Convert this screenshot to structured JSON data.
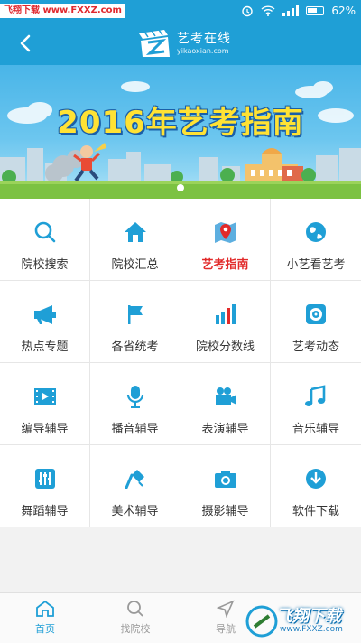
{
  "status_bar": {
    "watermark": "飞翔下载 www.FXXZ.com",
    "battery": "62%"
  },
  "header": {
    "back_icon": "chevron-left-icon",
    "logo_cn": "艺考在线",
    "logo_en": "yikaoxian.com"
  },
  "banner": {
    "title": "2016年艺考指南",
    "slides": 2,
    "active_slide": 0
  },
  "grid": [
    {
      "label": "院校搜索",
      "icon": "search-icon",
      "color": "#1f9fd6",
      "active": false
    },
    {
      "label": "院校汇总",
      "icon": "home-icon",
      "color": "#1f9fd6",
      "active": false
    },
    {
      "label": "艺考指南",
      "icon": "map-pin-icon",
      "color": "#e22a2a",
      "active": true
    },
    {
      "label": "小艺看艺考",
      "icon": "globe-icon",
      "color": "#1f9fd6",
      "active": false
    },
    {
      "label": "热点专题",
      "icon": "megaphone-icon",
      "color": "#1f9fd6",
      "active": false
    },
    {
      "label": "各省统考",
      "icon": "flag-icon",
      "color": "#1f9fd6",
      "active": false
    },
    {
      "label": "院校分数线",
      "icon": "bar-chart-icon",
      "color": "#1f9fd6",
      "active": false
    },
    {
      "label": "艺考动态",
      "icon": "speaker-icon",
      "color": "#1f9fd6",
      "active": false
    },
    {
      "label": "编导辅导",
      "icon": "film-icon",
      "color": "#1f9fd6",
      "active": false
    },
    {
      "label": "播音辅导",
      "icon": "microphone-icon",
      "color": "#1f9fd6",
      "active": false
    },
    {
      "label": "表演辅导",
      "icon": "video-camera-icon",
      "color": "#1f9fd6",
      "active": false
    },
    {
      "label": "音乐辅导",
      "icon": "music-note-icon",
      "color": "#1f9fd6",
      "active": false
    },
    {
      "label": "舞蹈辅导",
      "icon": "equalizer-icon",
      "color": "#1f9fd6",
      "active": false
    },
    {
      "label": "美术辅导",
      "icon": "paint-roller-icon",
      "color": "#1f9fd6",
      "active": false
    },
    {
      "label": "摄影辅导",
      "icon": "camera-icon",
      "color": "#1f9fd6",
      "active": false
    },
    {
      "label": "软件下载",
      "icon": "download-icon",
      "color": "#1f9fd6",
      "active": false
    }
  ],
  "bottom_nav": [
    {
      "label": "首页",
      "icon": "home-outline-icon",
      "active": true
    },
    {
      "label": "找院校",
      "icon": "search-icon",
      "active": false
    },
    {
      "label": "导航",
      "icon": "navigation-icon",
      "active": false
    }
  ],
  "watermark_br": {
    "text": "飞翔下载",
    "url": "www.FXXZ.com"
  },
  "colors": {
    "brand": "#1f9fd6",
    "active": "#e22a2a"
  }
}
